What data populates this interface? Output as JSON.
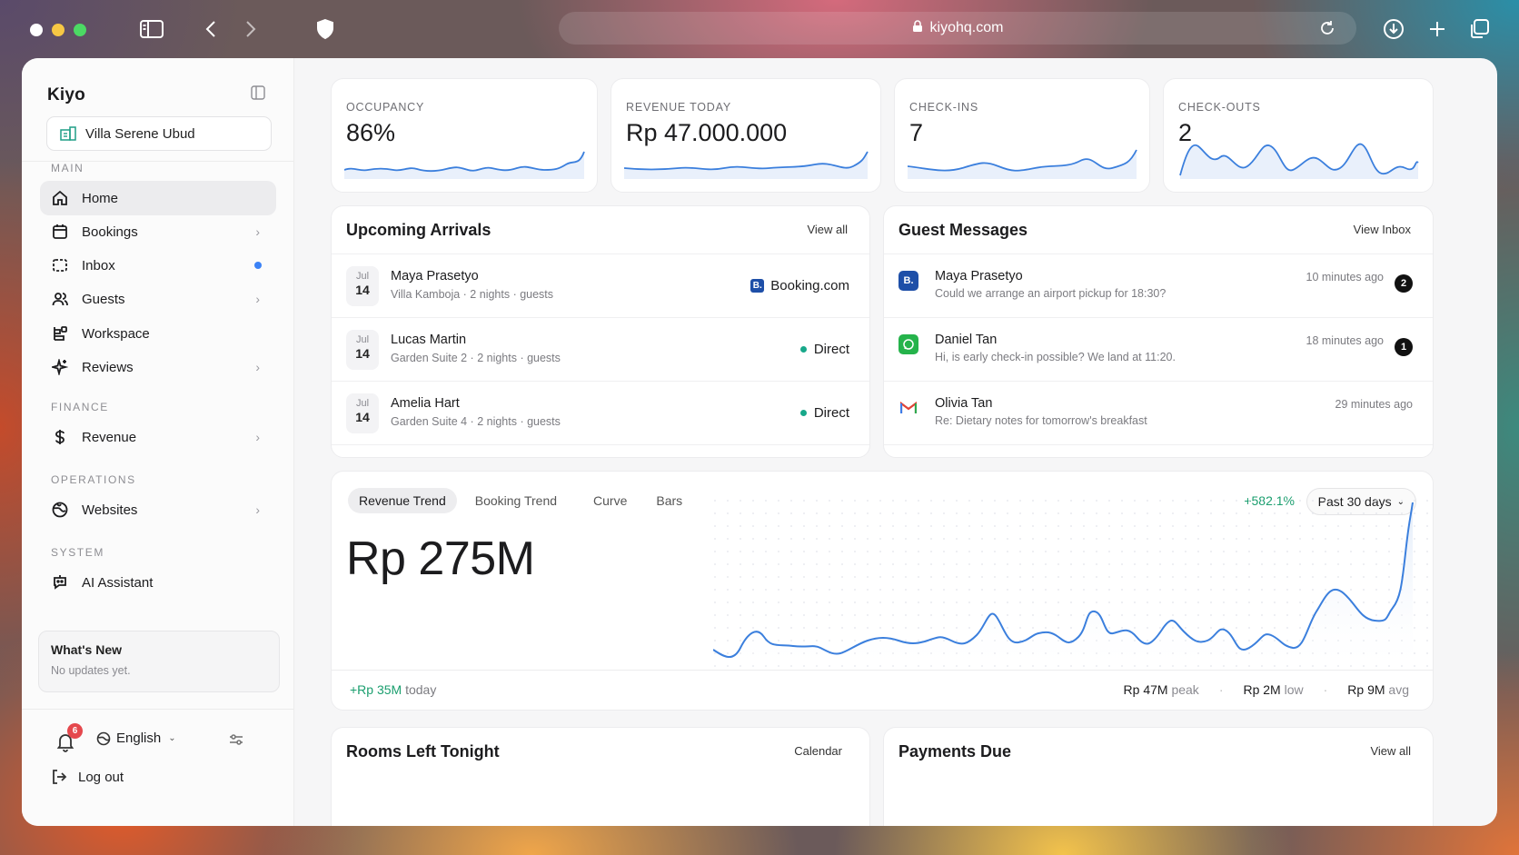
{
  "browser": {
    "url": "kiyohq.com"
  },
  "sidebar": {
    "brand": "Kiyo",
    "property": "Villa Serene Ubud",
    "sections": {
      "main": "MAIN",
      "finance": "FINANCE",
      "operations": "OPERATIONS",
      "system": "SYSTEM"
    },
    "items": [
      {
        "label": "Home",
        "icon": "home-icon",
        "active": true
      },
      {
        "label": "Bookings",
        "icon": "calendar-icon"
      },
      {
        "label": "Inbox",
        "icon": "inbox-icon",
        "unread": true
      },
      {
        "label": "Guests",
        "icon": "users-icon"
      },
      {
        "label": "Workspace",
        "icon": "workspace-icon"
      },
      {
        "label": "Reviews",
        "icon": "sparkle-icon"
      },
      {
        "label": "Revenue",
        "icon": "dollar-icon"
      },
      {
        "label": "Websites",
        "icon": "globe-icon"
      },
      {
        "label": "AI Assistant",
        "icon": "bot-icon"
      }
    ],
    "whats_new": {
      "title": "What's New",
      "subtitle": "No updates yet."
    },
    "notifications_count": "6",
    "language": "English",
    "logout": "Log out"
  },
  "kpis": [
    {
      "label": "OCCUPANCY",
      "value": "86%"
    },
    {
      "label": "REVENUE TODAY",
      "value": "Rp 47.000.000"
    },
    {
      "label": "CHECK-INS",
      "value": "7"
    },
    {
      "label": "CHECK-OUTS",
      "value": "2"
    }
  ],
  "arrivals": {
    "title": "Upcoming Arrivals",
    "link": "View all",
    "rows": [
      {
        "month": "Jul",
        "day": "14",
        "name": "Maya Prasetyo",
        "detail": "Villa Kamboja · 2 nights · guests",
        "source": "Booking.com"
      },
      {
        "month": "Jul",
        "day": "14",
        "name": "Lucas Martin",
        "detail": "Garden Suite 2 · 2 nights · guests",
        "source": "Direct"
      },
      {
        "month": "Jul",
        "day": "14",
        "name": "Amelia Hart",
        "detail": "Garden Suite 4 · 2 nights · guests",
        "source": "Direct"
      }
    ]
  },
  "messages": {
    "title": "Guest Messages",
    "link": "View Inbox",
    "rows": [
      {
        "name": "Maya Prasetyo",
        "text": "Could we arrange an airport pickup for 18:30?",
        "time": "10 minutes ago",
        "count": "2",
        "channel": "booking-icon"
      },
      {
        "name": "Daniel Tan",
        "text": "Hi, is early check-in possible? We land at 11:20.",
        "time": "18 minutes ago",
        "count": "1",
        "channel": "whatsapp-icon"
      },
      {
        "name": "Olivia Tan",
        "text": "Re: Dietary notes for tomorrow's breakfast",
        "time": "29 minutes ago",
        "channel": "gmail-icon"
      }
    ]
  },
  "trend": {
    "tabs": [
      "Revenue Trend",
      "Booking Trend",
      "Curve",
      "Bars"
    ],
    "active_tab": "Revenue Trend",
    "change": "+582.1%",
    "range": "Past 30 days",
    "total": "Rp 275M",
    "today_amount": "+Rp 35M",
    "today_label": "today",
    "peak": "Rp 47M",
    "peak_label": "peak",
    "low": "Rp 2M",
    "low_label": "low",
    "avg": "Rp 9M",
    "avg_label": "avg",
    "line_color": "#3b7fdd"
  },
  "rooms": {
    "title": "Rooms Left Tonight",
    "link": "Calendar"
  },
  "payments": {
    "title": "Payments Due",
    "link": "View all"
  }
}
